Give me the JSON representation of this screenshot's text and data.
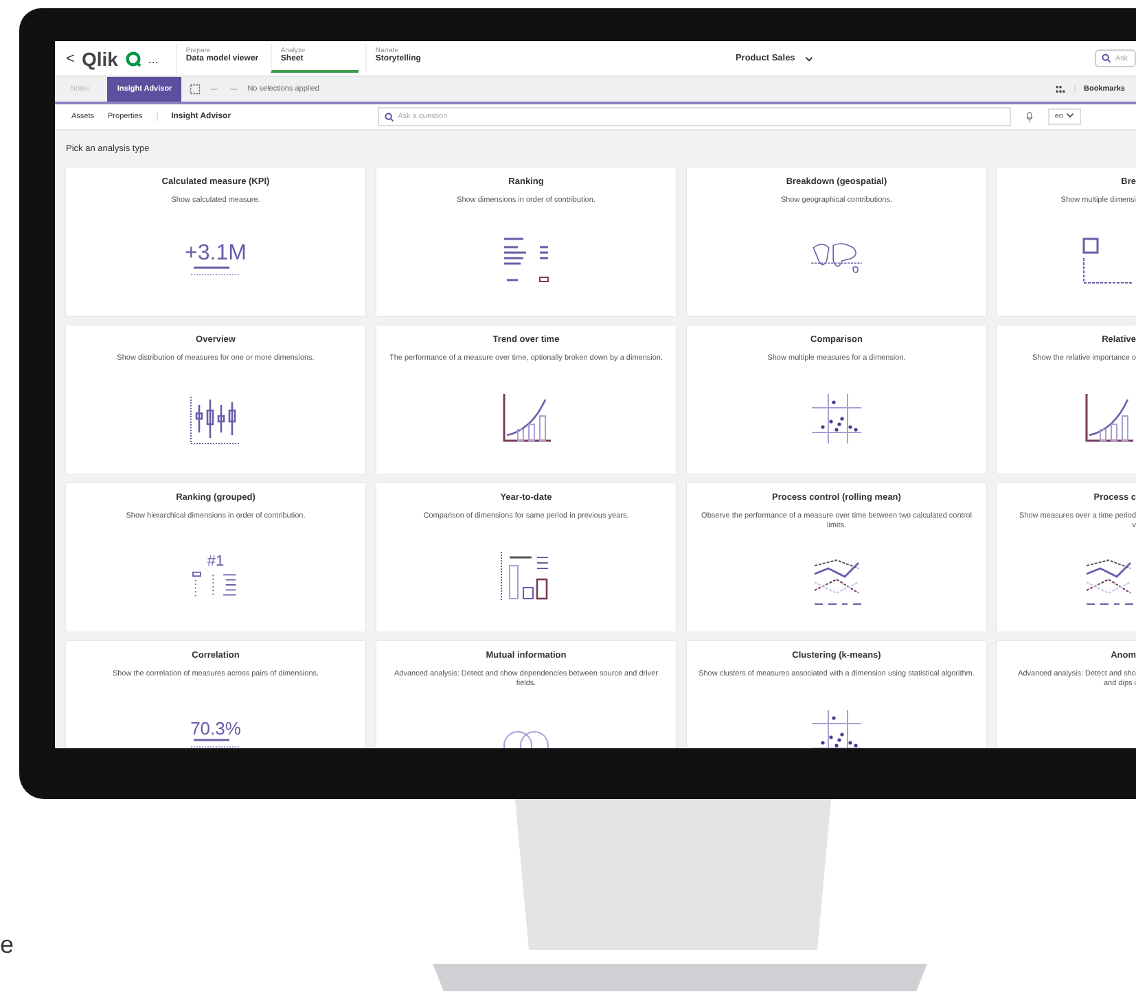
{
  "topbar": {
    "back": "<",
    "logo": "Qlik",
    "more": "...",
    "tabs": [
      {
        "over": "Prepare",
        "label": "Data model viewer",
        "selected": false
      },
      {
        "over": "Analyze",
        "label": "Sheet",
        "selected": true
      },
      {
        "over": "Narrate",
        "label": "Storytelling",
        "selected": false
      }
    ],
    "app_name": "Product Sales",
    "search_placeholder": "Ask"
  },
  "toolbar": {
    "buttons": [
      {
        "label": "Notes",
        "selected": false,
        "disabled": true
      },
      {
        "label": "Insight Advisor",
        "selected": true,
        "disabled": false
      }
    ],
    "selections": "No selections applied",
    "bookmarks": "Bookmarks"
  },
  "subbar": {
    "assets": "Assets",
    "properties": "Properties",
    "title": "Insight Advisor",
    "search_placeholder": "Ask a question",
    "language": "en"
  },
  "heading": "Pick an analysis type",
  "cards": [
    {
      "kind": "kpi",
      "title": "Calculated measure (KPI)",
      "description": "Show calculated measure.",
      "figure_text": "+3.1M"
    },
    {
      "kind": "ranking",
      "title": "Ranking",
      "description": "Show dimensions in order of contribution."
    },
    {
      "kind": "geo",
      "title": "Breakdown (geospatial)",
      "description": "Show geographical contributions."
    },
    {
      "kind": "breakdown",
      "title": "Bre",
      "description": "Show multiple dimensi"
    },
    {
      "kind": "overview",
      "title": "Overview",
      "description": "Show distribution of measures for one or more dimensions."
    },
    {
      "kind": "trend",
      "title": "Trend over time",
      "description": "The performance of a measure over time, optionally broken down by a dimension."
    },
    {
      "kind": "comparison",
      "title": "Comparison",
      "description": "Show multiple measures for a dimension."
    },
    {
      "kind": "relative",
      "title": "Relative",
      "description": "Show the relative importance o"
    },
    {
      "kind": "ranking_grouped",
      "title": "Ranking (grouped)",
      "description": "Show hierarchical dimensions in order of contribution.",
      "figure_text": "#1"
    },
    {
      "kind": "ytd",
      "title": "Year-to-date",
      "description": "Comparison of dimensions for same period in previous years."
    },
    {
      "kind": "control",
      "title": "Process control (rolling mean)",
      "description": "Observe the performance of a measure over time between two calculated control limits."
    },
    {
      "kind": "control2",
      "title": "Process c",
      "description": "Show measures over a time period\nv"
    },
    {
      "kind": "correlation",
      "title": "Correlation",
      "description": "Show the correlation of measures across pairs of dimensions.",
      "figure_text": "70.3%"
    },
    {
      "kind": "mutual",
      "title": "Mutual information",
      "description": "Advanced analysis: Detect and show dependencies between source and driver fields."
    },
    {
      "kind": "clustering",
      "title": "Clustering (k-means)",
      "description": "Show clusters of measures associated with a dimension using statistical algorithm."
    },
    {
      "kind": "anomaly",
      "title": "Anom",
      "description": "Advanced analysis: Detect and sho\nand dips i"
    }
  ],
  "side_text": "e"
}
